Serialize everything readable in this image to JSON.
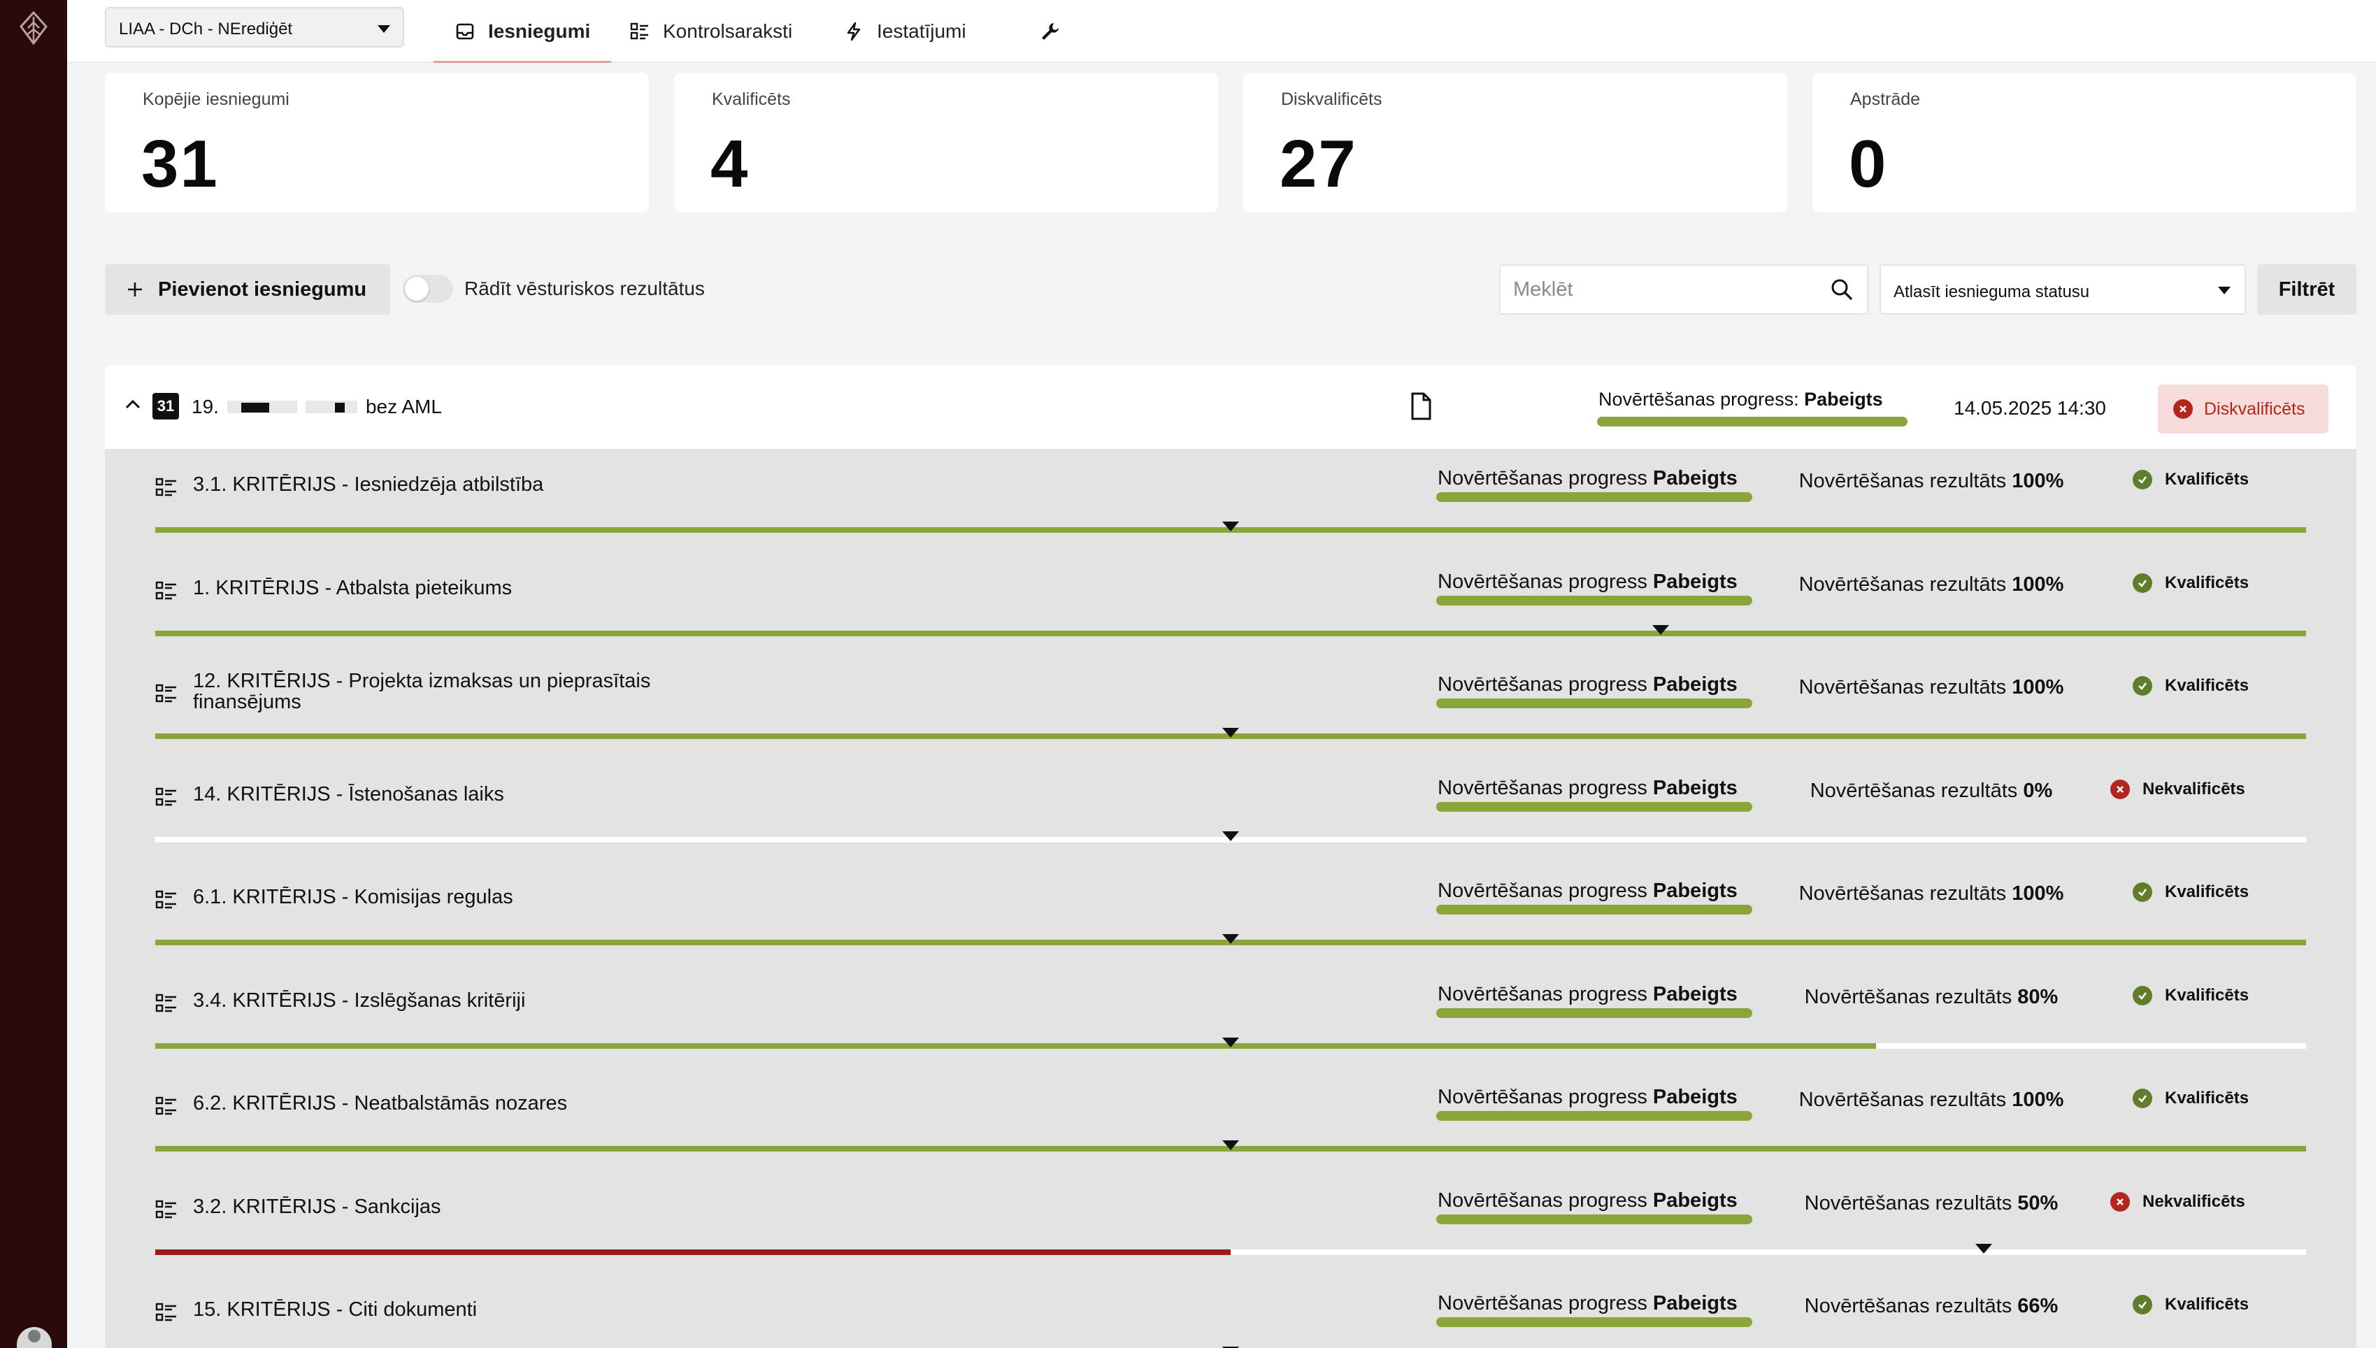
{
  "project": {
    "selected": "LIAA - DCh - NErediģēt"
  },
  "nav": {
    "tabs": [
      {
        "label": "Iesniegumi",
        "icon": "inbox-icon",
        "active": true
      },
      {
        "label": "Kontrolsaraksti",
        "icon": "checklist-icon",
        "active": false
      },
      {
        "label": "Iestatījumi",
        "icon": "lightning-icon",
        "active": false
      }
    ],
    "tools_icon": "wrench-icon"
  },
  "stats": [
    {
      "label": "Kopējie iesniegumi",
      "value": "31"
    },
    {
      "label": "Kvalificēts",
      "value": "4"
    },
    {
      "label": "Diskvalificēts",
      "value": "27"
    },
    {
      "label": "Apstrāde",
      "value": "0"
    }
  ],
  "toolbar": {
    "add_label": "Pievienot iesniegumu",
    "history_toggle_label": "Rādīt vēsturiskos rezultātus",
    "history_toggle_on": false,
    "search_placeholder": "Meklēt",
    "status_placeholder": "Atlasīt iesnieguma statusu",
    "filter_label": "Filtrēt"
  },
  "submission": {
    "calendar_day": "31",
    "number": "19.",
    "title_suffix": "bez AML",
    "progress_label": "Novērtēšanas progress:",
    "progress_value": "Pabeigts",
    "progress_fraction": 1.0,
    "date": "14.05.2025 14:30",
    "status": "Diskvalificēts",
    "colors": {
      "accent_green": "#8aa63a",
      "disqualified_bg": "#f7dcdc",
      "disqualified_text": "#b3261e"
    }
  },
  "criteria": [
    {
      "name": "3.1. KRITĒRIJS - Iesniedzēja atbilstība",
      "progress_label": "Novērtēšanas progress",
      "progress_value": "Pabeigts",
      "result_label": "Novērtēšanas rezultāts",
      "result_value": "100%",
      "result_fraction": 1.0,
      "threshold_fraction": 0.5,
      "status": "Kvalificēts",
      "qualified": true
    },
    {
      "name": "1. KRITĒRIJS - Atbalsta pieteikums",
      "progress_label": "Novērtēšanas progress",
      "progress_value": "Pabeigts",
      "result_label": "Novērtēšanas rezultāts",
      "result_value": "100%",
      "result_fraction": 1.0,
      "threshold_fraction": 0.7,
      "status": "Kvalificēts",
      "qualified": true
    },
    {
      "name": "12. KRITĒRIJS - Projekta izmaksas un pieprasītais finansējums",
      "progress_label": "Novērtēšanas progress",
      "progress_value": "Pabeigts",
      "result_label": "Novērtēšanas rezultāts",
      "result_value": "100%",
      "result_fraction": 1.0,
      "threshold_fraction": 0.5,
      "status": "Kvalificēts",
      "qualified": true
    },
    {
      "name": "14. KRITĒRIJS - Īstenošanas laiks",
      "progress_label": "Novērtēšanas progress",
      "progress_value": "Pabeigts",
      "result_label": "Novērtēšanas rezultāts",
      "result_value": "0%",
      "result_fraction": 0.0,
      "threshold_fraction": 0.5,
      "status": "Nekvalificēts",
      "qualified": false
    },
    {
      "name": "6.1. KRITĒRIJS - Komisijas regulas",
      "progress_label": "Novērtēšanas progress",
      "progress_value": "Pabeigts",
      "result_label": "Novērtēšanas rezultāts",
      "result_value": "100%",
      "result_fraction": 1.0,
      "threshold_fraction": 0.5,
      "status": "Kvalificēts",
      "qualified": true
    },
    {
      "name": "3.4. KRITĒRIJS - Izslēgšanas kritēriji",
      "progress_label": "Novērtēšanas progress",
      "progress_value": "Pabeigts",
      "result_label": "Novērtēšanas rezultāts",
      "result_value": "80%",
      "result_fraction": 0.8,
      "threshold_fraction": 0.5,
      "status": "Kvalificēts",
      "qualified": true
    },
    {
      "name": "6.2. KRITĒRIJS - Neatbalstāmās nozares",
      "progress_label": "Novērtēšanas progress",
      "progress_value": "Pabeigts",
      "result_label": "Novērtēšanas rezultāts",
      "result_value": "100%",
      "result_fraction": 1.0,
      "threshold_fraction": 0.5,
      "status": "Kvalificēts",
      "qualified": true
    },
    {
      "name": "3.2. KRITĒRIJS - Sankcijas",
      "progress_label": "Novērtēšanas progress",
      "progress_value": "Pabeigts",
      "result_label": "Novērtēšanas rezultāts",
      "result_value": "50%",
      "result_fraction": 0.5,
      "threshold_fraction": 0.85,
      "status": "Nekvalificēts",
      "qualified": false
    },
    {
      "name": "15. KRITĒRIJS - Citi dokumenti",
      "progress_label": "Novērtēšanas progress",
      "progress_value": "Pabeigts",
      "result_label": "Novērtēšanas rezultāts",
      "result_value": "66%",
      "result_fraction": 0.66,
      "threshold_fraction": 0.5,
      "status": "Kvalificēts",
      "qualified": true
    }
  ]
}
